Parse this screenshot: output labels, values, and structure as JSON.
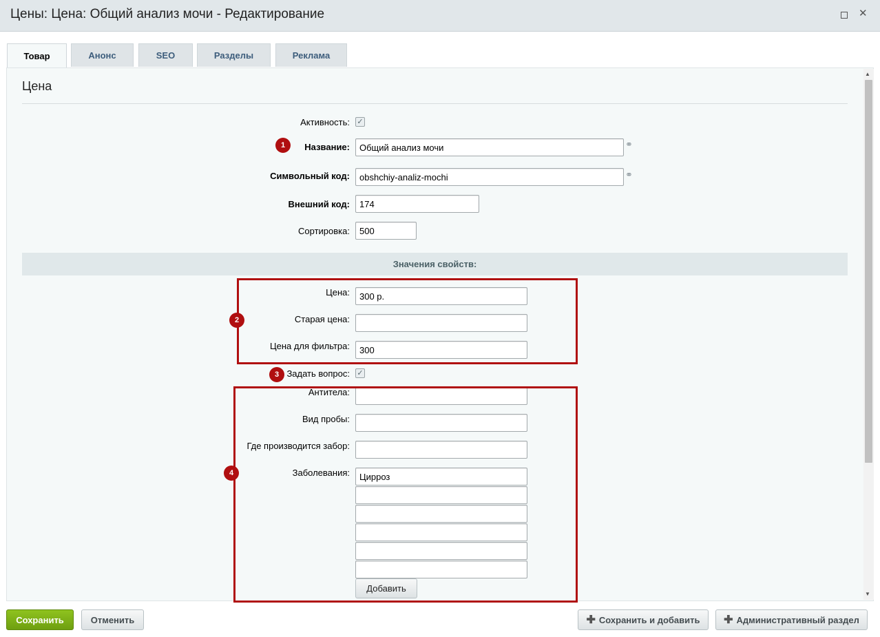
{
  "window": {
    "title": "Цены: Цена: Общий анализ мочи - Редактирование",
    "maximize_icon": "maximize-icon",
    "close_icon": "close-icon",
    "close_glyph": "✕"
  },
  "tabs": [
    {
      "label": "Товар",
      "active": true
    },
    {
      "label": "Анонс"
    },
    {
      "label": "SEO"
    },
    {
      "label": "Разделы"
    },
    {
      "label": "Реклама"
    }
  ],
  "section": {
    "title": "Цена"
  },
  "fields": {
    "active": {
      "label": "Активность:",
      "checked": true
    },
    "name": {
      "label": "Название:",
      "value": "Общий анализ мочи"
    },
    "code": {
      "label": "Символьный код:",
      "value": "obshchiy-analiz-mochi"
    },
    "external_code": {
      "label": "Внешний код:",
      "value": "174"
    },
    "sort": {
      "label": "Сортировка:",
      "value": "500"
    }
  },
  "properties": {
    "header": "Значения свойств:",
    "price": {
      "label": "Цена:",
      "value": "300 р."
    },
    "old_price": {
      "label": "Старая цена:",
      "value": ""
    },
    "filter_price": {
      "label": "Цена для фильтра:",
      "value": "300"
    },
    "ask_question": {
      "label": "Задать вопрос:",
      "checked": true
    },
    "antibodies": {
      "label": "Антитела:",
      "value": ""
    },
    "sample_type": {
      "label": "Вид пробы:",
      "value": ""
    },
    "collection_place": {
      "label": "Где производится забор:",
      "value": ""
    },
    "diseases": {
      "label": "Заболевания:",
      "values": [
        "Цирроз",
        "",
        "",
        "",
        "",
        ""
      ]
    },
    "add_button": "Добавить"
  },
  "markers": [
    "1",
    "2",
    "3",
    "4"
  ],
  "footer": {
    "save": "Сохранить",
    "cancel": "Отменить",
    "save_and_add": "Сохранить и добавить",
    "admin_section": "Административный раздел"
  },
  "colors": {
    "annotation_red": "#b00f10",
    "save_green": "#7cb013",
    "tab_text": "#3d5d7c"
  }
}
